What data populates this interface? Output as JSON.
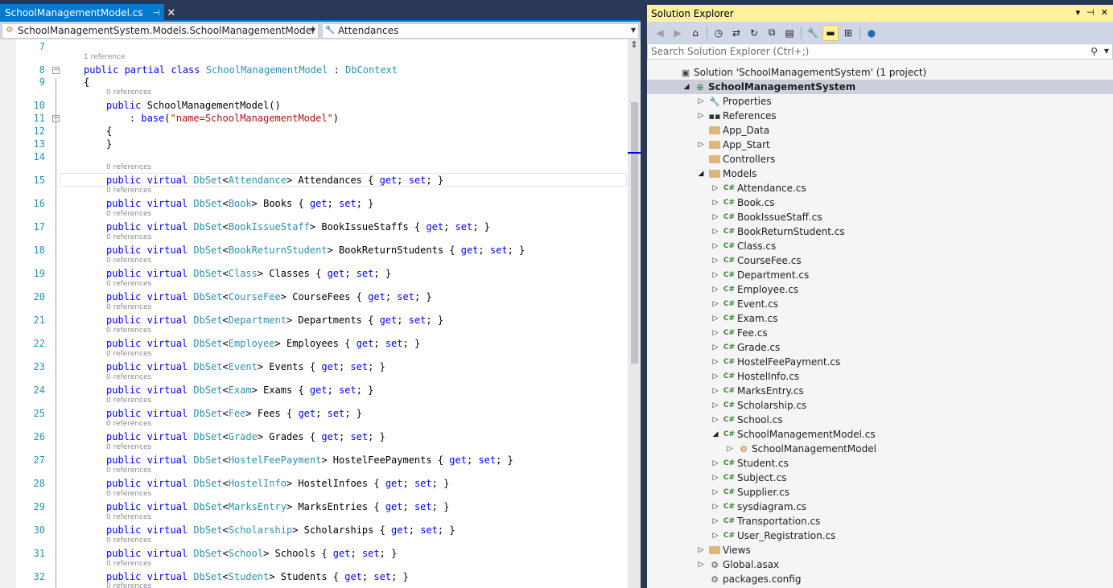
{
  "editor": {
    "tab": {
      "title": "SchoolManagementModel.cs",
      "pin": "⊣",
      "close": "✕"
    },
    "nav": {
      "left": "SchoolManagementSystem.Models.SchoolManagementModel",
      "right": "Attendances"
    },
    "lines": [
      {
        "num": "7",
        "lens": null,
        "tokens": []
      },
      {
        "num": "8",
        "lens": "1 reference",
        "tokens": [
          [
            "kw",
            "public partial class "
          ],
          [
            "ty",
            "SchoolManagementModel"
          ],
          [
            "plain",
            " : "
          ],
          [
            "ty",
            "DbContext"
          ]
        ]
      },
      {
        "num": "9",
        "lens": null,
        "tokens": [
          [
            "plain",
            "{"
          ]
        ]
      },
      {
        "num": "10",
        "lens": "0 references",
        "tokens": [
          [
            "kw",
            "public "
          ],
          [
            "plain",
            "SchoolManagementModel()"
          ]
        ]
      },
      {
        "num": "11",
        "lens": null,
        "tokens": [
          [
            "plain",
            "    : "
          ],
          [
            "kw",
            "base"
          ],
          [
            "plain",
            "("
          ],
          [
            "str",
            "\"name=SchoolManagementModel\""
          ],
          [
            "plain",
            ")"
          ]
        ]
      },
      {
        "num": "12",
        "lens": null,
        "tokens": [
          [
            "plain",
            "{"
          ]
        ]
      },
      {
        "num": "13",
        "lens": null,
        "tokens": [
          [
            "plain",
            "}"
          ]
        ]
      },
      {
        "num": "14",
        "lens": null,
        "tokens": []
      },
      {
        "num": "15",
        "lens": "0 references",
        "tokens": [
          [
            "kw",
            "public virtual "
          ],
          [
            "ty",
            "DbSet"
          ],
          [
            "plain",
            "<"
          ],
          [
            "ty",
            "Attendance"
          ],
          [
            "plain",
            "> Attendances { "
          ],
          [
            "kw",
            "get"
          ],
          [
            "plain",
            "; "
          ],
          [
            "kw",
            "set"
          ],
          [
            "plain",
            "; }"
          ]
        ]
      },
      {
        "num": "16",
        "lens": "0 references",
        "tokens": [
          [
            "kw",
            "public virtual "
          ],
          [
            "ty",
            "DbSet"
          ],
          [
            "plain",
            "<"
          ],
          [
            "ty",
            "Book"
          ],
          [
            "plain",
            "> Books { "
          ],
          [
            "kw",
            "get"
          ],
          [
            "plain",
            "; "
          ],
          [
            "kw",
            "set"
          ],
          [
            "plain",
            "; }"
          ]
        ]
      },
      {
        "num": "17",
        "lens": "0 references",
        "tokens": [
          [
            "kw",
            "public virtual "
          ],
          [
            "ty",
            "DbSet"
          ],
          [
            "plain",
            "<"
          ],
          [
            "ty",
            "BookIssueStaff"
          ],
          [
            "plain",
            "> BookIssueStaffs { "
          ],
          [
            "kw",
            "get"
          ],
          [
            "plain",
            "; "
          ],
          [
            "kw",
            "set"
          ],
          [
            "plain",
            "; }"
          ]
        ]
      },
      {
        "num": "18",
        "lens": "0 references",
        "tokens": [
          [
            "kw",
            "public virtual "
          ],
          [
            "ty",
            "DbSet"
          ],
          [
            "plain",
            "<"
          ],
          [
            "ty",
            "BookReturnStudent"
          ],
          [
            "plain",
            "> BookReturnStudents { "
          ],
          [
            "kw",
            "get"
          ],
          [
            "plain",
            "; "
          ],
          [
            "kw",
            "set"
          ],
          [
            "plain",
            "; }"
          ]
        ]
      },
      {
        "num": "19",
        "lens": "0 references",
        "tokens": [
          [
            "kw",
            "public virtual "
          ],
          [
            "ty",
            "DbSet"
          ],
          [
            "plain",
            "<"
          ],
          [
            "ty",
            "Class"
          ],
          [
            "plain",
            "> Classes { "
          ],
          [
            "kw",
            "get"
          ],
          [
            "plain",
            "; "
          ],
          [
            "kw",
            "set"
          ],
          [
            "plain",
            "; }"
          ]
        ]
      },
      {
        "num": "20",
        "lens": "0 references",
        "tokens": [
          [
            "kw",
            "public virtual "
          ],
          [
            "ty",
            "DbSet"
          ],
          [
            "plain",
            "<"
          ],
          [
            "ty",
            "CourseFee"
          ],
          [
            "plain",
            "> CourseFees { "
          ],
          [
            "kw",
            "get"
          ],
          [
            "plain",
            "; "
          ],
          [
            "kw",
            "set"
          ],
          [
            "plain",
            "; }"
          ]
        ]
      },
      {
        "num": "21",
        "lens": "0 references",
        "tokens": [
          [
            "kw",
            "public virtual "
          ],
          [
            "ty",
            "DbSet"
          ],
          [
            "plain",
            "<"
          ],
          [
            "ty",
            "Department"
          ],
          [
            "plain",
            "> Departments { "
          ],
          [
            "kw",
            "get"
          ],
          [
            "plain",
            "; "
          ],
          [
            "kw",
            "set"
          ],
          [
            "plain",
            "; }"
          ]
        ]
      },
      {
        "num": "22",
        "lens": "0 references",
        "tokens": [
          [
            "kw",
            "public virtual "
          ],
          [
            "ty",
            "DbSet"
          ],
          [
            "plain",
            "<"
          ],
          [
            "ty",
            "Employee"
          ],
          [
            "plain",
            "> Employees { "
          ],
          [
            "kw",
            "get"
          ],
          [
            "plain",
            "; "
          ],
          [
            "kw",
            "set"
          ],
          [
            "plain",
            "; }"
          ]
        ]
      },
      {
        "num": "23",
        "lens": "0 references",
        "tokens": [
          [
            "kw",
            "public virtual "
          ],
          [
            "ty",
            "DbSet"
          ],
          [
            "plain",
            "<"
          ],
          [
            "ty",
            "Event"
          ],
          [
            "plain",
            "> Events { "
          ],
          [
            "kw",
            "get"
          ],
          [
            "plain",
            "; "
          ],
          [
            "kw",
            "set"
          ],
          [
            "plain",
            "; }"
          ]
        ]
      },
      {
        "num": "24",
        "lens": "0 references",
        "tokens": [
          [
            "kw",
            "public virtual "
          ],
          [
            "ty",
            "DbSet"
          ],
          [
            "plain",
            "<"
          ],
          [
            "ty",
            "Exam"
          ],
          [
            "plain",
            "> Exams { "
          ],
          [
            "kw",
            "get"
          ],
          [
            "plain",
            "; "
          ],
          [
            "kw",
            "set"
          ],
          [
            "plain",
            "; }"
          ]
        ]
      },
      {
        "num": "25",
        "lens": "0 references",
        "tokens": [
          [
            "kw",
            "public virtual "
          ],
          [
            "ty",
            "DbSet"
          ],
          [
            "plain",
            "<"
          ],
          [
            "ty",
            "Fee"
          ],
          [
            "plain",
            "> Fees { "
          ],
          [
            "kw",
            "get"
          ],
          [
            "plain",
            "; "
          ],
          [
            "kw",
            "set"
          ],
          [
            "plain",
            "; }"
          ]
        ]
      },
      {
        "num": "26",
        "lens": "0 references",
        "tokens": [
          [
            "kw",
            "public virtual "
          ],
          [
            "ty",
            "DbSet"
          ],
          [
            "plain",
            "<"
          ],
          [
            "ty",
            "Grade"
          ],
          [
            "plain",
            "> Grades { "
          ],
          [
            "kw",
            "get"
          ],
          [
            "plain",
            "; "
          ],
          [
            "kw",
            "set"
          ],
          [
            "plain",
            "; }"
          ]
        ]
      },
      {
        "num": "27",
        "lens": "0 references",
        "tokens": [
          [
            "kw",
            "public virtual "
          ],
          [
            "ty",
            "DbSet"
          ],
          [
            "plain",
            "<"
          ],
          [
            "ty",
            "HostelFeePayment"
          ],
          [
            "plain",
            "> HostelFeePayments { "
          ],
          [
            "kw",
            "get"
          ],
          [
            "plain",
            "; "
          ],
          [
            "kw",
            "set"
          ],
          [
            "plain",
            "; }"
          ]
        ]
      },
      {
        "num": "28",
        "lens": "0 references",
        "tokens": [
          [
            "kw",
            "public virtual "
          ],
          [
            "ty",
            "DbSet"
          ],
          [
            "plain",
            "<"
          ],
          [
            "ty",
            "HostelInfo"
          ],
          [
            "plain",
            "> HostelInfoes { "
          ],
          [
            "kw",
            "get"
          ],
          [
            "plain",
            "; "
          ],
          [
            "kw",
            "set"
          ],
          [
            "plain",
            "; }"
          ]
        ]
      },
      {
        "num": "29",
        "lens": "0 references",
        "tokens": [
          [
            "kw",
            "public virtual "
          ],
          [
            "ty",
            "DbSet"
          ],
          [
            "plain",
            "<"
          ],
          [
            "ty",
            "MarksEntry"
          ],
          [
            "plain",
            "> MarksEntries { "
          ],
          [
            "kw",
            "get"
          ],
          [
            "plain",
            "; "
          ],
          [
            "kw",
            "set"
          ],
          [
            "plain",
            "; }"
          ]
        ]
      },
      {
        "num": "30",
        "lens": "0 references",
        "tokens": [
          [
            "kw",
            "public virtual "
          ],
          [
            "ty",
            "DbSet"
          ],
          [
            "plain",
            "<"
          ],
          [
            "ty",
            "Scholarship"
          ],
          [
            "plain",
            "> Scholarships { "
          ],
          [
            "kw",
            "get"
          ],
          [
            "plain",
            "; "
          ],
          [
            "kw",
            "set"
          ],
          [
            "plain",
            "; }"
          ]
        ]
      },
      {
        "num": "31",
        "lens": "0 references",
        "tokens": [
          [
            "kw",
            "public virtual "
          ],
          [
            "ty",
            "DbSet"
          ],
          [
            "plain",
            "<"
          ],
          [
            "ty",
            "School"
          ],
          [
            "plain",
            "> Schools { "
          ],
          [
            "kw",
            "get"
          ],
          [
            "plain",
            "; "
          ],
          [
            "kw",
            "set"
          ],
          [
            "plain",
            "; }"
          ]
        ]
      },
      {
        "num": "32",
        "lens": "0 references",
        "tokens": [
          [
            "kw",
            "public virtual "
          ],
          [
            "ty",
            "DbSet"
          ],
          [
            "plain",
            "<"
          ],
          [
            "ty",
            "Student"
          ],
          [
            "plain",
            "> Students { "
          ],
          [
            "kw",
            "get"
          ],
          [
            "plain",
            "; "
          ],
          [
            "kw",
            "set"
          ],
          [
            "plain",
            "; }"
          ]
        ]
      }
    ],
    "trailing_lens": "0 references"
  },
  "solution_explorer": {
    "title": "Solution Explorer",
    "title_buttons": [
      "▾",
      "⊣",
      "✕"
    ],
    "search_placeholder": "Search Solution Explorer (Ctrl+;)",
    "toolbar_icons": [
      "back-icon",
      "forward-icon",
      "home-icon",
      "history-icon",
      "sync-icon",
      "refresh-icon",
      "collapse-all-icon",
      "show-all-files-icon",
      "properties-icon",
      "preview-icon",
      "view-class-diagram-icon",
      "pending-changes-icon"
    ],
    "tree": [
      {
        "label": "Solution 'SchoolManagementSystem' (1 project)",
        "depth": 0,
        "exp": "",
        "icon": "solution"
      },
      {
        "label": "SchoolManagementSystem",
        "depth": 1,
        "exp": "◢",
        "icon": "project",
        "bold": true,
        "selected": true
      },
      {
        "label": "Properties",
        "depth": 2,
        "exp": "▷",
        "icon": "wrench"
      },
      {
        "label": "References",
        "depth": 2,
        "exp": "▷",
        "icon": "refs"
      },
      {
        "label": "App_Data",
        "depth": 2,
        "exp": "",
        "icon": "folder"
      },
      {
        "label": "App_Start",
        "depth": 2,
        "exp": "▷",
        "icon": "folder"
      },
      {
        "label": "Controllers",
        "depth": 2,
        "exp": "",
        "icon": "folder"
      },
      {
        "label": "Models",
        "depth": 2,
        "exp": "◢",
        "icon": "folder"
      },
      {
        "label": "Attendance.cs",
        "depth": 3,
        "exp": "▷",
        "icon": "cs"
      },
      {
        "label": "Book.cs",
        "depth": 3,
        "exp": "▷",
        "icon": "cs"
      },
      {
        "label": "BookIssueStaff.cs",
        "depth": 3,
        "exp": "▷",
        "icon": "cs"
      },
      {
        "label": "BookReturnStudent.cs",
        "depth": 3,
        "exp": "▷",
        "icon": "cs"
      },
      {
        "label": "Class.cs",
        "depth": 3,
        "exp": "▷",
        "icon": "cs"
      },
      {
        "label": "CourseFee.cs",
        "depth": 3,
        "exp": "▷",
        "icon": "cs"
      },
      {
        "label": "Department.cs",
        "depth": 3,
        "exp": "▷",
        "icon": "cs"
      },
      {
        "label": "Employee.cs",
        "depth": 3,
        "exp": "▷",
        "icon": "cs"
      },
      {
        "label": "Event.cs",
        "depth": 3,
        "exp": "▷",
        "icon": "cs"
      },
      {
        "label": "Exam.cs",
        "depth": 3,
        "exp": "▷",
        "icon": "cs"
      },
      {
        "label": "Fee.cs",
        "depth": 3,
        "exp": "▷",
        "icon": "cs"
      },
      {
        "label": "Grade.cs",
        "depth": 3,
        "exp": "▷",
        "icon": "cs"
      },
      {
        "label": "HostelFeePayment.cs",
        "depth": 3,
        "exp": "▷",
        "icon": "cs"
      },
      {
        "label": "HostelInfo.cs",
        "depth": 3,
        "exp": "▷",
        "icon": "cs"
      },
      {
        "label": "MarksEntry.cs",
        "depth": 3,
        "exp": "▷",
        "icon": "cs"
      },
      {
        "label": "Scholarship.cs",
        "depth": 3,
        "exp": "▷",
        "icon": "cs"
      },
      {
        "label": "School.cs",
        "depth": 3,
        "exp": "▷",
        "icon": "cs"
      },
      {
        "label": "SchoolManagementModel.cs",
        "depth": 3,
        "exp": "◢",
        "icon": "cs"
      },
      {
        "label": "SchoolManagementModel",
        "depth": 4,
        "exp": "▷",
        "icon": "class"
      },
      {
        "label": "Student.cs",
        "depth": 3,
        "exp": "▷",
        "icon": "cs"
      },
      {
        "label": "Subject.cs",
        "depth": 3,
        "exp": "▷",
        "icon": "cs"
      },
      {
        "label": "Supplier.cs",
        "depth": 3,
        "exp": "▷",
        "icon": "cs"
      },
      {
        "label": "sysdiagram.cs",
        "depth": 3,
        "exp": "▷",
        "icon": "cs"
      },
      {
        "label": "Transportation.cs",
        "depth": 3,
        "exp": "▷",
        "icon": "cs"
      },
      {
        "label": "User_Registration.cs",
        "depth": 3,
        "exp": "▷",
        "icon": "cs"
      },
      {
        "label": "Views",
        "depth": 2,
        "exp": "▷",
        "icon": "folder"
      },
      {
        "label": "Global.asax",
        "depth": 2,
        "exp": "▷",
        "icon": "file"
      },
      {
        "label": "packages.config",
        "depth": 2,
        "exp": "",
        "icon": "config"
      }
    ]
  },
  "colors": {
    "accent": "#007acc",
    "frame": "#293955",
    "se_title": "#fff29d",
    "keyword": "#0000ff",
    "type": "#2b91af",
    "string": "#a31515",
    "linenum": "#2b91af",
    "cs_icon": "#388a34",
    "folder": "#dcb67a"
  }
}
